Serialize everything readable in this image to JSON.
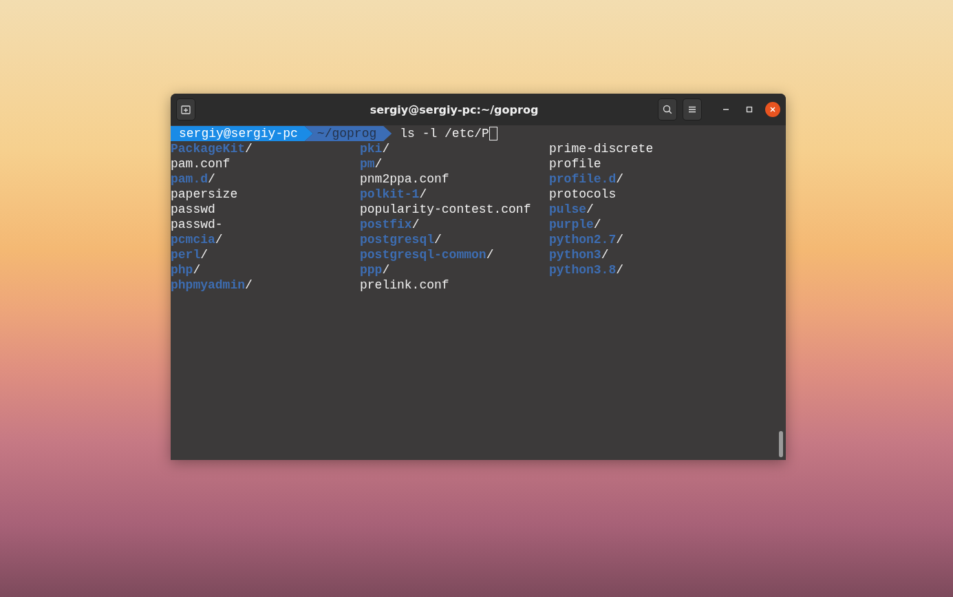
{
  "window": {
    "title": "sergiy@sergiy-pc:~/goprog"
  },
  "prompt": {
    "user_host": "sergiy@sergiy-pc",
    "path": "~/goprog",
    "command": "ls -l /etc/P"
  },
  "listing": [
    [
      {
        "name": "PackageKit",
        "kind": "dir",
        "suffix": "/"
      },
      {
        "name": "pam.conf",
        "kind": "file"
      },
      {
        "name": "pam.d",
        "kind": "dir",
        "suffix": "/"
      },
      {
        "name": "papersize",
        "kind": "file"
      },
      {
        "name": "passwd",
        "kind": "file"
      },
      {
        "name": "passwd-",
        "kind": "file"
      },
      {
        "name": "pcmcia",
        "kind": "dir",
        "suffix": "/"
      },
      {
        "name": "perl",
        "kind": "dir",
        "suffix": "/"
      },
      {
        "name": "php",
        "kind": "dir",
        "suffix": "/"
      },
      {
        "name": "phpmyadmin",
        "kind": "dir",
        "suffix": "/"
      }
    ],
    [
      {
        "name": "pki",
        "kind": "dir",
        "suffix": "/"
      },
      {
        "name": "pm",
        "kind": "dir",
        "suffix": "/"
      },
      {
        "name": "pnm2ppa.conf",
        "kind": "file"
      },
      {
        "name": "polkit-1",
        "kind": "dir",
        "suffix": "/"
      },
      {
        "name": "popularity-contest.conf",
        "kind": "file"
      },
      {
        "name": "postfix",
        "kind": "dir",
        "suffix": "/"
      },
      {
        "name": "postgresql",
        "kind": "dir",
        "suffix": "/"
      },
      {
        "name": "postgresql-common",
        "kind": "dir",
        "suffix": "/"
      },
      {
        "name": "ppp",
        "kind": "dir",
        "suffix": "/"
      },
      {
        "name": "prelink.conf",
        "kind": "file"
      }
    ],
    [
      {
        "name": "prime-discrete",
        "kind": "file"
      },
      {
        "name": "profile",
        "kind": "file"
      },
      {
        "name": "profile.d",
        "kind": "dir",
        "suffix": "/"
      },
      {
        "name": "protocols",
        "kind": "file"
      },
      {
        "name": "pulse",
        "kind": "dir",
        "suffix": "/"
      },
      {
        "name": "purple",
        "kind": "dir",
        "suffix": "/"
      },
      {
        "name": "python2.7",
        "kind": "dir",
        "suffix": "/"
      },
      {
        "name": "python3",
        "kind": "dir",
        "suffix": "/"
      },
      {
        "name": "python3.8",
        "kind": "dir",
        "suffix": "/"
      }
    ]
  ]
}
